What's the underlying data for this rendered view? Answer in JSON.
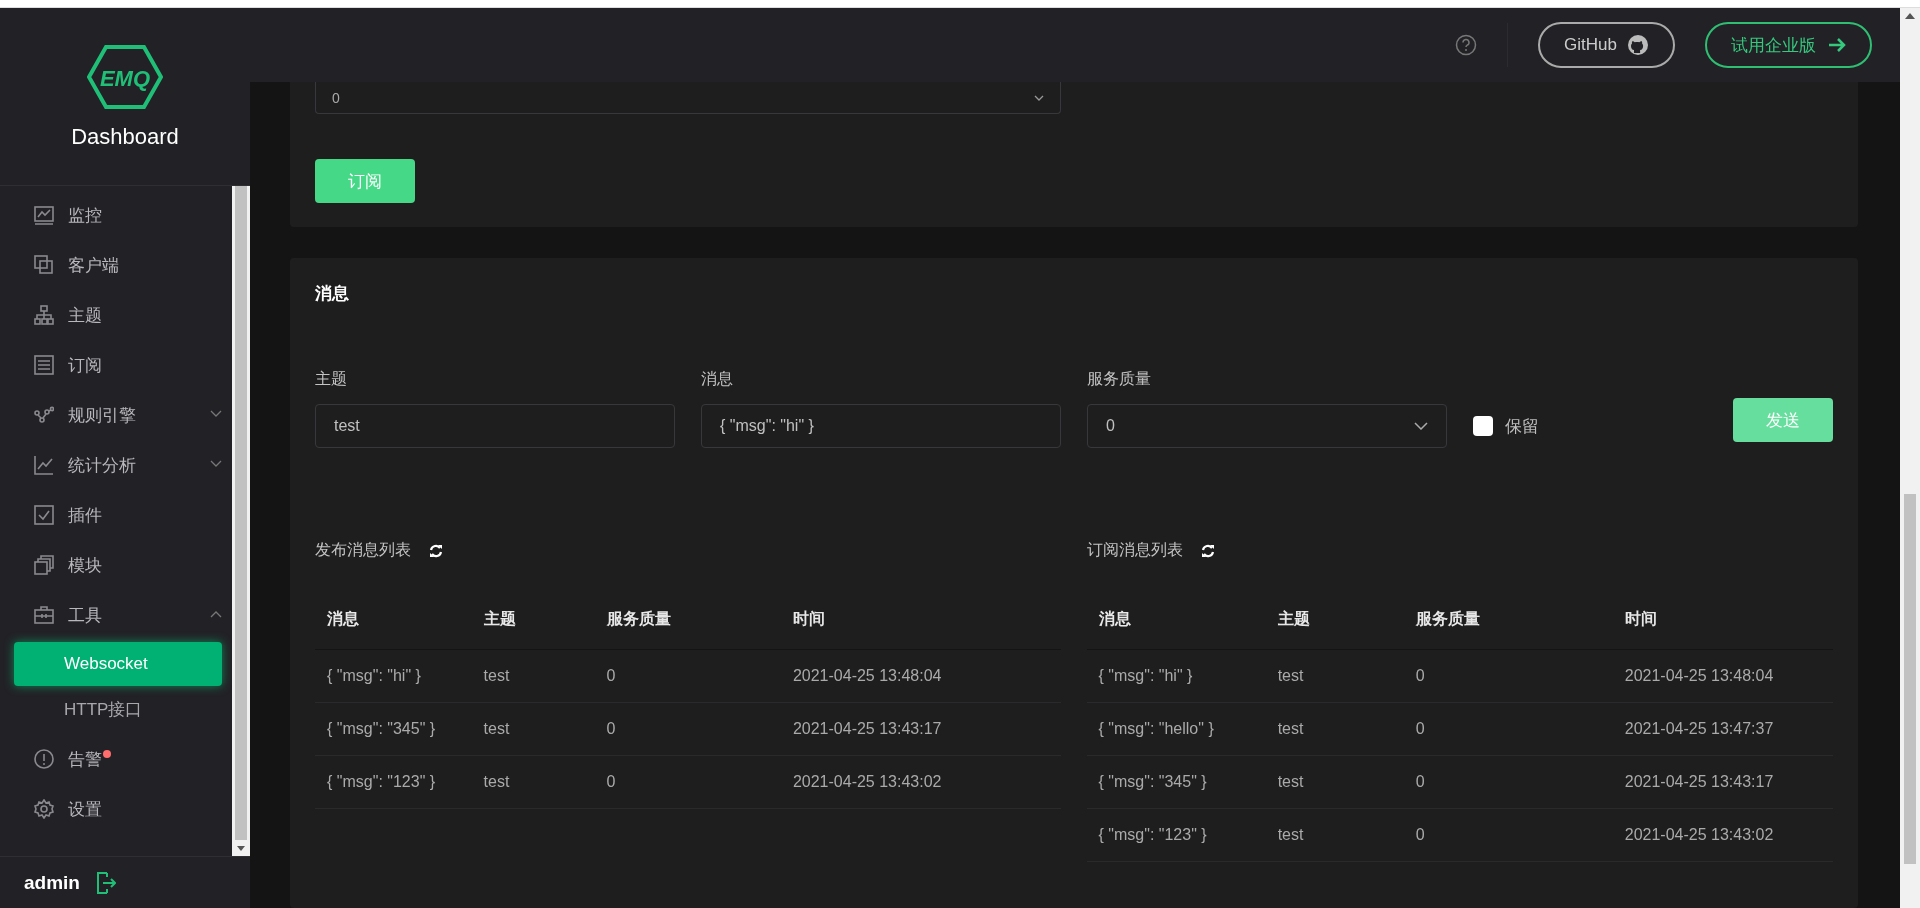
{
  "sidebar": {
    "logo": "EMQ",
    "brand": "Dashboard",
    "items": [
      {
        "label": "监控",
        "kind": "item",
        "selected": false,
        "badge": false
      },
      {
        "label": "客户端",
        "kind": "item",
        "selected": false,
        "badge": false
      },
      {
        "label": "主题",
        "kind": "item",
        "selected": false,
        "badge": false
      },
      {
        "label": "订阅",
        "kind": "item",
        "selected": false,
        "badge": false
      },
      {
        "label": "规则引擎",
        "kind": "group",
        "expanded": false,
        "selected": false,
        "badge": false
      },
      {
        "label": "统计分析",
        "kind": "group",
        "expanded": false,
        "selected": false,
        "badge": false
      },
      {
        "label": "插件",
        "kind": "item",
        "selected": false,
        "badge": false
      },
      {
        "label": "模块",
        "kind": "item",
        "selected": false,
        "badge": false
      },
      {
        "label": "工具",
        "kind": "group",
        "expanded": true,
        "selected": false,
        "badge": false,
        "children": [
          {
            "label": "Websocket",
            "selected": true
          },
          {
            "label": "HTTP接口",
            "selected": false
          }
        ]
      },
      {
        "label": "告警",
        "kind": "item",
        "selected": false,
        "badge": true
      },
      {
        "label": "设置",
        "kind": "item",
        "selected": false,
        "badge": false
      }
    ],
    "user": "admin"
  },
  "header": {
    "github": "GitHub",
    "enterprise": "试用企业版"
  },
  "subscribe": {
    "qos": "0",
    "button": "订阅"
  },
  "message": {
    "title": "消息",
    "fields": [
      {
        "label": "主题",
        "value": "test",
        "kind": "input"
      },
      {
        "label": "消息",
        "value": "{ \"msg\": \"hi\" }",
        "kind": "input"
      },
      {
        "label": "服务质量",
        "value": "0",
        "kind": "select"
      }
    ],
    "retain": {
      "label": "保留",
      "checked": false
    },
    "send": "发送",
    "tables": [
      {
        "title": "发布消息列表",
        "columns": [
          "消息",
          "主题",
          "服务质量",
          "时间"
        ],
        "rows": [
          [
            "{ \"msg\": \"hi\" }",
            "test",
            "0",
            "2021-04-25 13:48:04"
          ],
          [
            "{ \"msg\": \"345\" }",
            "test",
            "0",
            "2021-04-25 13:43:17"
          ],
          [
            "{ \"msg\": \"123\" }",
            "test",
            "0",
            "2021-04-25 13:43:02"
          ]
        ]
      },
      {
        "title": "订阅消息列表",
        "columns": [
          "消息",
          "主题",
          "服务质量",
          "时间"
        ],
        "rows": [
          [
            "{ \"msg\": \"hi\" }",
            "test",
            "0",
            "2021-04-25 13:48:04"
          ],
          [
            "{ \"msg\": \"hello\" }",
            "test",
            "0",
            "2021-04-25 13:47:37"
          ],
          [
            "{ \"msg\": \"345\" }",
            "test",
            "0",
            "2021-04-25 13:43:17"
          ],
          [
            "{ \"msg\": \"123\" }",
            "test",
            "0",
            "2021-04-25 13:43:02"
          ]
        ]
      }
    ]
  }
}
